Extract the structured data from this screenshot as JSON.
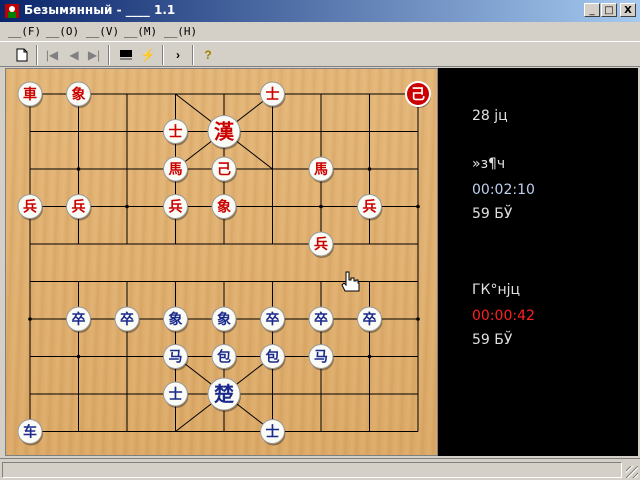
{
  "window": {
    "title": "Безымянный - ____ 1.1",
    "minimize": "_",
    "maximize": "□",
    "close": "X"
  },
  "menu": [
    {
      "label": "__(F)"
    },
    {
      "label": "__(O)"
    },
    {
      "label": "__(V)"
    },
    {
      "label": "__(M)"
    },
    {
      "label": "__(H)"
    }
  ],
  "toolbar": {
    "buttons": [
      "new-file-icon",
      "first-move-icon",
      "prev-move-icon",
      "next-move-icon",
      "last-move-icon",
      "computer-icon",
      "hint-icon",
      "forward-icon",
      "help-icon"
    ]
  },
  "info": {
    "move_count": "28 јц",
    "top_player_name": "»з¶ч",
    "top_player_time": "00:02:10",
    "top_player_steps": "59 БЎ",
    "bottom_player_name": "ГК°нјц",
    "bottom_player_time": "00:00:42",
    "bottom_player_steps": "59 БЎ"
  },
  "colors": {
    "red_side": "#cc0000",
    "blue_side": "#1a2a8c",
    "timer_active": "#ff2020",
    "timer_idle": "#c0d0f0",
    "panel_bg": "#000000",
    "info_text": "#e0e0e0",
    "board_wood": "#e0b06e"
  },
  "board": {
    "files": 9,
    "ranks": 10,
    "pieces": [
      {
        "side": "red",
        "glyph": "車",
        "file": 0,
        "rank": 0
      },
      {
        "side": "red",
        "glyph": "象",
        "file": 1,
        "rank": 0
      },
      {
        "side": "red",
        "glyph": "士",
        "file": 5,
        "rank": 0
      },
      {
        "side": "red",
        "glyph": "己",
        "file": 8,
        "rank": 0,
        "highlight": true
      },
      {
        "side": "red",
        "glyph": "士",
        "file": 3,
        "rank": 1
      },
      {
        "side": "red",
        "glyph": "漢",
        "file": 4,
        "rank": 1
      },
      {
        "side": "red",
        "glyph": "馬",
        "file": 3,
        "rank": 2
      },
      {
        "side": "red",
        "glyph": "己",
        "file": 4,
        "rank": 2
      },
      {
        "side": "red",
        "glyph": "馬",
        "file": 6,
        "rank": 2
      },
      {
        "side": "red",
        "glyph": "兵",
        "file": 0,
        "rank": 3
      },
      {
        "side": "red",
        "glyph": "兵",
        "file": 1,
        "rank": 3
      },
      {
        "side": "red",
        "glyph": "兵",
        "file": 3,
        "rank": 3
      },
      {
        "side": "red",
        "glyph": "象",
        "file": 4,
        "rank": 3
      },
      {
        "side": "red",
        "glyph": "兵",
        "file": 7,
        "rank": 3
      },
      {
        "side": "red",
        "glyph": "兵",
        "file": 6,
        "rank": 4
      },
      {
        "side": "blue",
        "glyph": "卒",
        "file": 1,
        "rank": 6
      },
      {
        "side": "blue",
        "glyph": "卒",
        "file": 2,
        "rank": 6
      },
      {
        "side": "blue",
        "glyph": "象",
        "file": 3,
        "rank": 6
      },
      {
        "side": "blue",
        "glyph": "象",
        "file": 4,
        "rank": 6
      },
      {
        "side": "blue",
        "glyph": "卒",
        "file": 5,
        "rank": 6
      },
      {
        "side": "blue",
        "glyph": "卒",
        "file": 6,
        "rank": 6
      },
      {
        "side": "blue",
        "glyph": "卒",
        "file": 7,
        "rank": 6
      },
      {
        "side": "blue",
        "glyph": "马",
        "file": 3,
        "rank": 7
      },
      {
        "side": "blue",
        "glyph": "包",
        "file": 4,
        "rank": 7
      },
      {
        "side": "blue",
        "glyph": "包",
        "file": 5,
        "rank": 7
      },
      {
        "side": "blue",
        "glyph": "马",
        "file": 6,
        "rank": 7
      },
      {
        "side": "blue",
        "glyph": "士",
        "file": 3,
        "rank": 8
      },
      {
        "side": "blue",
        "glyph": "楚",
        "file": 4,
        "rank": 8
      },
      {
        "side": "blue",
        "glyph": "车",
        "file": 0,
        "rank": 9
      },
      {
        "side": "blue",
        "glyph": "士",
        "file": 5,
        "rank": 9
      }
    ]
  }
}
